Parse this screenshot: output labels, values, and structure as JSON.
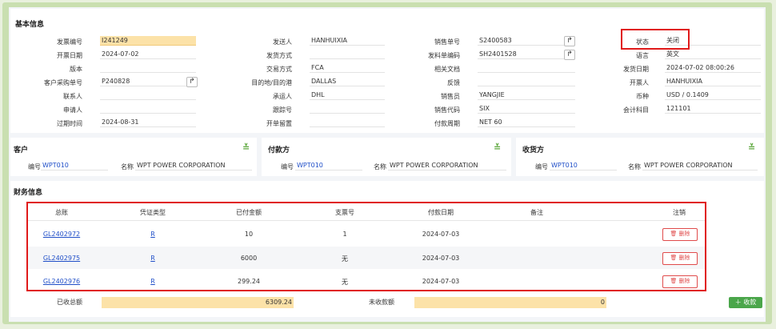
{
  "basic": {
    "title": "基本信息",
    "col1": [
      {
        "label": "发票编号",
        "value": "I241249"
      },
      {
        "label": "开票日期",
        "value": "2024-07-02"
      },
      {
        "label": "版本",
        "value": ""
      },
      {
        "label": "客户采购单号",
        "value": "P240828"
      },
      {
        "label": "联系人",
        "value": ""
      },
      {
        "label": "申请人",
        "value": ""
      },
      {
        "label": "过期时间",
        "value": "2024-08-31"
      }
    ],
    "col2": [
      {
        "label": "发送人",
        "value": "HANHUIXIA"
      },
      {
        "label": "发货方式",
        "value": ""
      },
      {
        "label": "交易方式",
        "value": "FCA"
      },
      {
        "label": "目的地/目的港",
        "value": "DALLAS"
      },
      {
        "label": "承运人",
        "value": "DHL"
      },
      {
        "label": "跟踪号",
        "value": ""
      },
      {
        "label": "开单留置",
        "value": ""
      }
    ],
    "col3": [
      {
        "label": "销售单号",
        "value": "S2400583"
      },
      {
        "label": "发料单编码",
        "value": "SH2401528"
      },
      {
        "label": "相关文档",
        "value": ""
      },
      {
        "label": "反馈",
        "value": ""
      },
      {
        "label": "销售员",
        "value": "YANGJIE"
      },
      {
        "label": "销售代码",
        "value": "SIX"
      },
      {
        "label": "付款周期",
        "value": "NET 60"
      }
    ],
    "col4": [
      {
        "label": "状态",
        "value": "关闭"
      },
      {
        "label": "语言",
        "value": "英文"
      },
      {
        "label": "发货日期",
        "value": "2024-07-02 08:00:26"
      },
      {
        "label": "开票人",
        "value": "HANHUIXIA"
      },
      {
        "label": "币种",
        "value": "USD / 0.1409"
      },
      {
        "label": "会计科目",
        "value": "121101"
      }
    ]
  },
  "parties": [
    {
      "title": "客户",
      "code_label": "编号",
      "code": "WPT010",
      "name_label": "名称",
      "name": "WPT POWER CORPORATION"
    },
    {
      "title": "付款方",
      "code_label": "编号",
      "code": "WPT010",
      "name_label": "名称",
      "name": "WPT POWER CORPORATION"
    },
    {
      "title": "收货方",
      "code_label": "编号",
      "code": "WPT010",
      "name_label": "名称",
      "name": "WPT POWER CORPORATION"
    }
  ],
  "finance": {
    "title": "财务信息",
    "headers": [
      "总账",
      "凭证类型",
      "已付金额",
      "支票号",
      "付款日期",
      "备注",
      "注销"
    ],
    "rows": [
      {
        "ledger": "GL2402972",
        "type": "R",
        "amount": "10",
        "check": "1",
        "date": "2024-07-03",
        "note": "",
        "action": "删除"
      },
      {
        "ledger": "GL2402975",
        "type": "R",
        "amount": "6000",
        "check": "无",
        "date": "2024-07-03",
        "note": "",
        "action": "删除"
      },
      {
        "ledger": "GL2402976",
        "type": "R",
        "amount": "299.24",
        "check": "无",
        "date": "2024-07-03",
        "note": "",
        "action": "删除"
      }
    ],
    "received_label": "已收总额",
    "received_value": "6309.24",
    "outstanding_label": "未收款额",
    "outstanding_value": "0",
    "collect_button": "收款"
  },
  "icons": {
    "arrow": "share-arrow-icon",
    "chevron": "chevron-double-down-icon",
    "trash": "trash-icon",
    "plus": "plus-icon"
  },
  "colors": {
    "highlight": "#fce2a8",
    "link": "#1f4ec8",
    "danger": "#e04b4b",
    "green": "#4aa64a",
    "annotation": "#e01a1a"
  }
}
